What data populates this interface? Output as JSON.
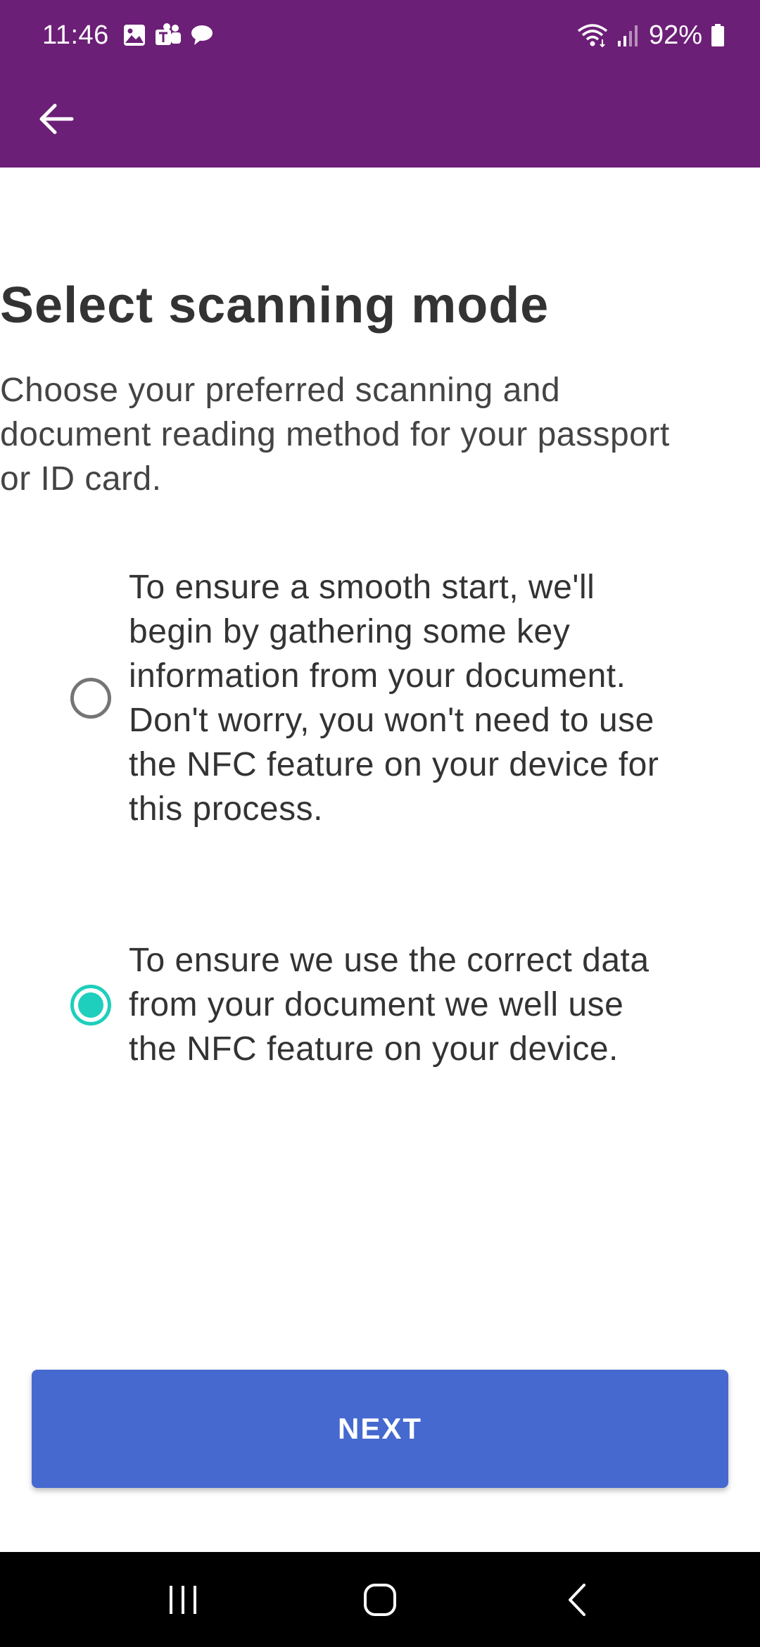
{
  "status_bar": {
    "time": "11:46",
    "battery": "92%",
    "left_icons": [
      "gallery-icon",
      "teams-icon",
      "chat-icon"
    ],
    "right_icons": [
      "wifi-icon",
      "signal-icon",
      "battery-icon"
    ]
  },
  "app_bar": {
    "background": "#6c1f77",
    "back_icon": "arrow-left-icon"
  },
  "page": {
    "title": "Select scanning mode",
    "subtitle": "Choose your preferred scanning and document reading method for your passport or ID card."
  },
  "options": [
    {
      "text": "To ensure a smooth start, we'll begin by gathering some key information from your document. Don't worry, you won't need to use the NFC feature on your device for this process.",
      "selected": false
    },
    {
      "text": "To ensure we use the correct data from your document we well use the NFC feature on your device.",
      "selected": true
    }
  ],
  "actions": {
    "next_label": "NEXT"
  },
  "colors": {
    "accent": "#1dcfbc",
    "primary_button": "#4669d0",
    "brand": "#6c1f77"
  },
  "nav_bar": {
    "icons": [
      "recent-apps-icon",
      "home-icon",
      "back-icon"
    ]
  }
}
